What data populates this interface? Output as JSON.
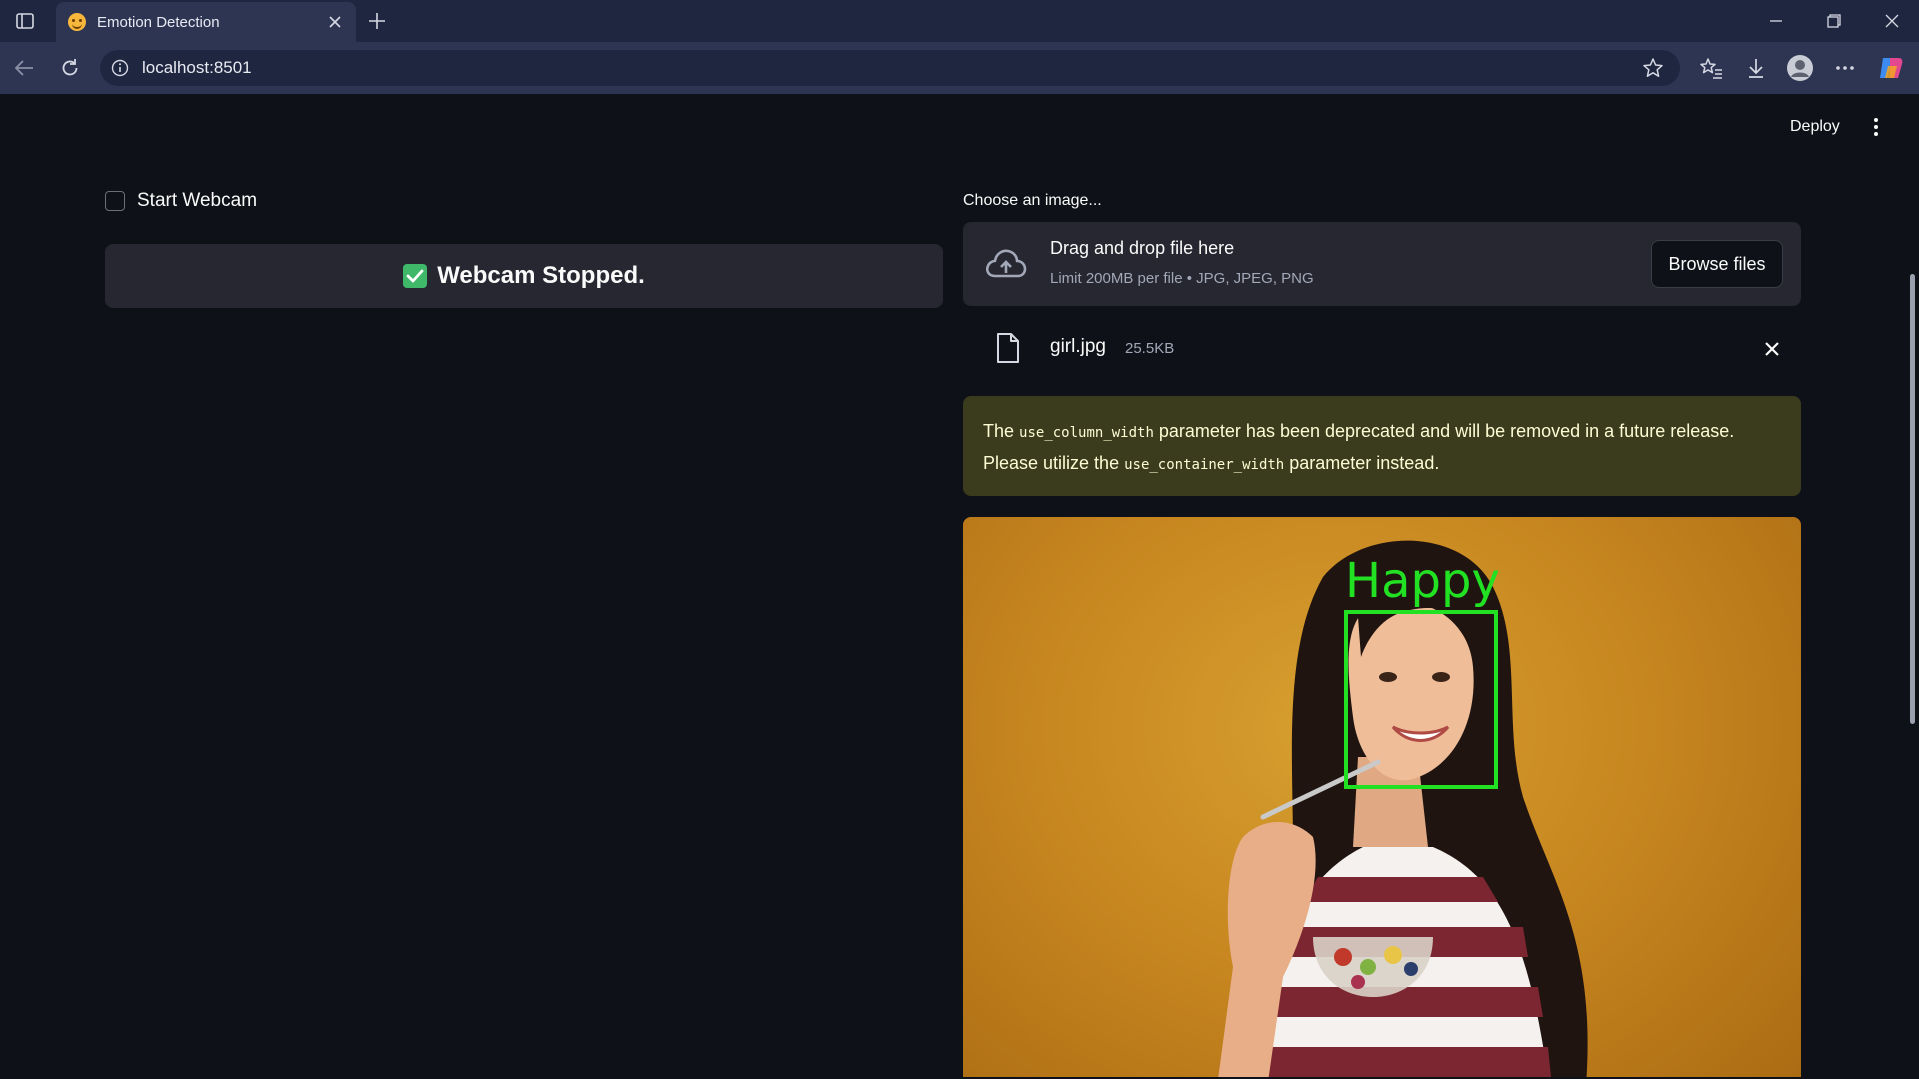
{
  "browser": {
    "tab_title": "Emotion Detection",
    "url": "localhost:8501"
  },
  "app": {
    "deploy_label": "Deploy",
    "webcam_checkbox_label": "Start Webcam",
    "webcam_checked": false,
    "status_message": "Webcam Stopped.",
    "uploader": {
      "label": "Choose an image...",
      "drop_title": "Drag and drop file here",
      "drop_subtitle": "Limit 200MB per file • JPG, JPEG, PNG",
      "browse_label": "Browse files"
    },
    "uploaded_file": {
      "name": "girl.jpg",
      "size": "25.5KB"
    },
    "warning": {
      "text_1": "The ",
      "code_1": "use_column_width",
      "text_2": " parameter has been deprecated and will be removed in a future release. Please utilize the ",
      "code_2": "use_container_width",
      "text_3": " parameter instead."
    },
    "result_image": {
      "emotion_label": "Happy",
      "box_color": "#22e022"
    }
  },
  "icons": {
    "accent_green": "#3fb86a"
  }
}
